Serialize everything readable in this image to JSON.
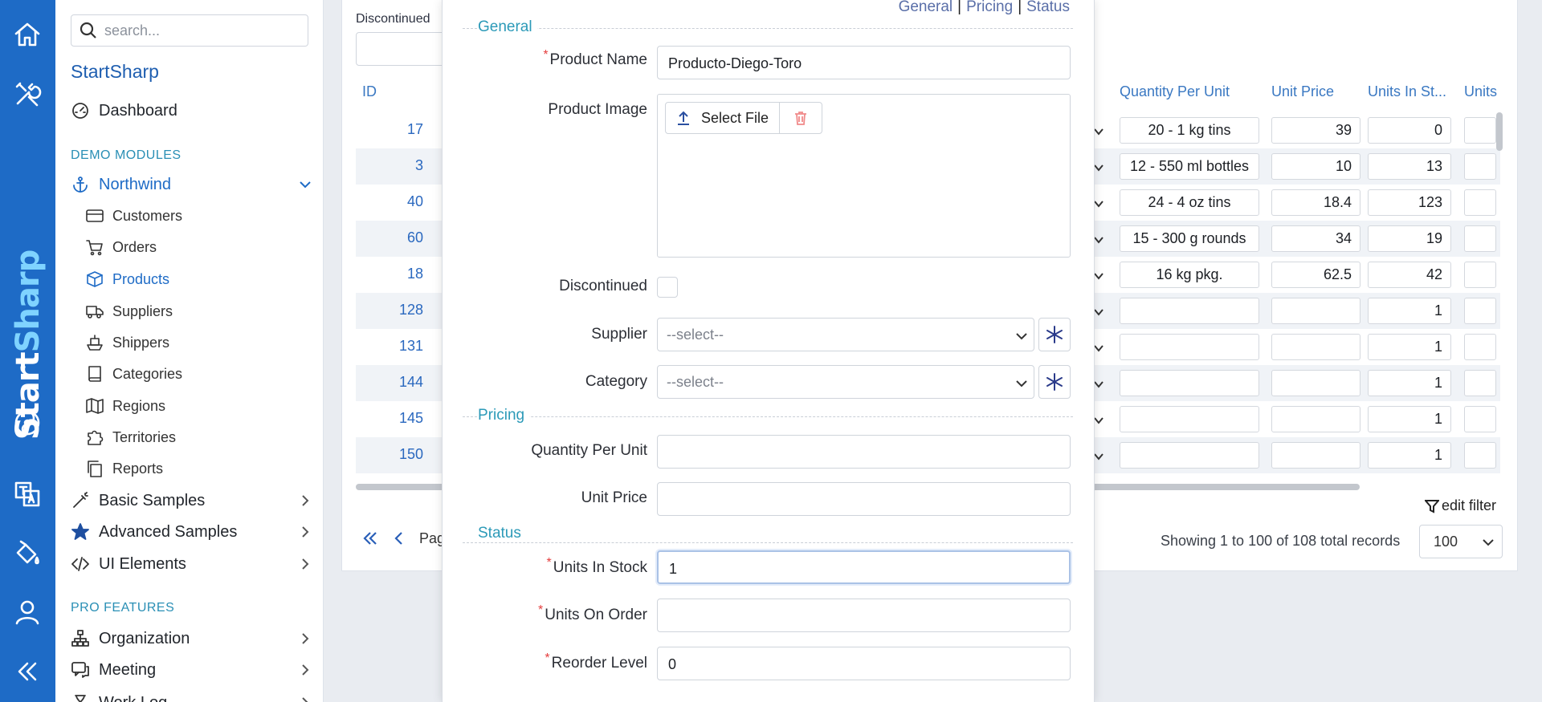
{
  "rail": {
    "brand_part1": "Start",
    "brand_part2": "Sharp",
    "icons": [
      "home-icon",
      "tools-icon",
      "translate-icon",
      "paint-bucket-icon",
      "user-icon",
      "collapse-icon"
    ]
  },
  "sidebar": {
    "search_placeholder": "search...",
    "app_title": "StartSharp",
    "dashboard": "Dashboard",
    "demo_modules_label": "DEMO MODULES",
    "northwind": "Northwind",
    "northwind_items": [
      {
        "label": "Customers",
        "icon": "credit-card-icon"
      },
      {
        "label": "Orders",
        "icon": "cart-icon"
      },
      {
        "label": "Products",
        "icon": "box-icon"
      },
      {
        "label": "Suppliers",
        "icon": "truck-icon"
      },
      {
        "label": "Shippers",
        "icon": "ship-icon"
      },
      {
        "label": "Categories",
        "icon": "book-icon"
      },
      {
        "label": "Regions",
        "icon": "map-icon"
      },
      {
        "label": "Territories",
        "icon": "puzzle-icon"
      },
      {
        "label": "Reports",
        "icon": "copy-icon"
      }
    ],
    "basic_samples": "Basic Samples",
    "advanced_samples": "Advanced Samples",
    "ui_elements": "UI Elements",
    "pro_features_label": "PRO FEATURES",
    "organization": "Organization",
    "meeting": "Meeting",
    "work_log": "Work Log"
  },
  "grid": {
    "discontinued_label": "Discontinued",
    "columns": {
      "id": "ID",
      "quantity_per_unit": "Quantity Per Unit",
      "unit_price": "Unit Price",
      "units_in_stock": "Units In St...",
      "units": "Units"
    },
    "rows": [
      {
        "id": "17",
        "qpu": "20 - 1 kg tins",
        "price": "39",
        "stock": "0"
      },
      {
        "id": "3",
        "qpu": "12 - 550 ml bottles",
        "price": "10",
        "stock": "13"
      },
      {
        "id": "40",
        "qpu": "24 - 4 oz tins",
        "price": "18.4",
        "stock": "123"
      },
      {
        "id": "60",
        "qpu": "15 - 300 g rounds",
        "price": "34",
        "stock": "19"
      },
      {
        "id": "18",
        "qpu": "16 kg pkg.",
        "price": "62.5",
        "stock": "42"
      },
      {
        "id": "128",
        "qpu": "",
        "price": "",
        "stock": "1"
      },
      {
        "id": "131",
        "qpu": "",
        "price": "",
        "stock": "1"
      },
      {
        "id": "144",
        "qpu": "",
        "price": "",
        "stock": "1"
      },
      {
        "id": "145",
        "qpu": "",
        "price": "",
        "stock": "1"
      },
      {
        "id": "150",
        "qpu": "",
        "price": "",
        "stock": "1"
      }
    ],
    "edit_filter": "edit filter",
    "status": "Showing 1 to 100 of 108 total records",
    "page_size": "100",
    "pager_text": "Pag"
  },
  "dialog": {
    "tabs": [
      "General",
      "Pricing",
      "Status"
    ],
    "categories": {
      "general": "General",
      "pricing": "Pricing",
      "status": "Status"
    },
    "fields": {
      "product_name": {
        "label": "Product Name",
        "value": "Producto-Diego-Toro"
      },
      "product_image": {
        "label": "Product Image",
        "button": "Select File"
      },
      "discontinued": {
        "label": "Discontinued"
      },
      "supplier": {
        "label": "Supplier",
        "value": "--select--"
      },
      "category": {
        "label": "Category",
        "value": "--select--"
      },
      "quantity_per_unit": {
        "label": "Quantity Per Unit",
        "value": ""
      },
      "unit_price": {
        "label": "Unit Price",
        "value": ""
      },
      "units_in_stock": {
        "label": "Units In Stock",
        "value": "1"
      },
      "units_on_order": {
        "label": "Units On Order",
        "value": ""
      },
      "reorder_level": {
        "label": "Reorder Level",
        "value": "0"
      }
    },
    "required_mark": "*"
  }
}
